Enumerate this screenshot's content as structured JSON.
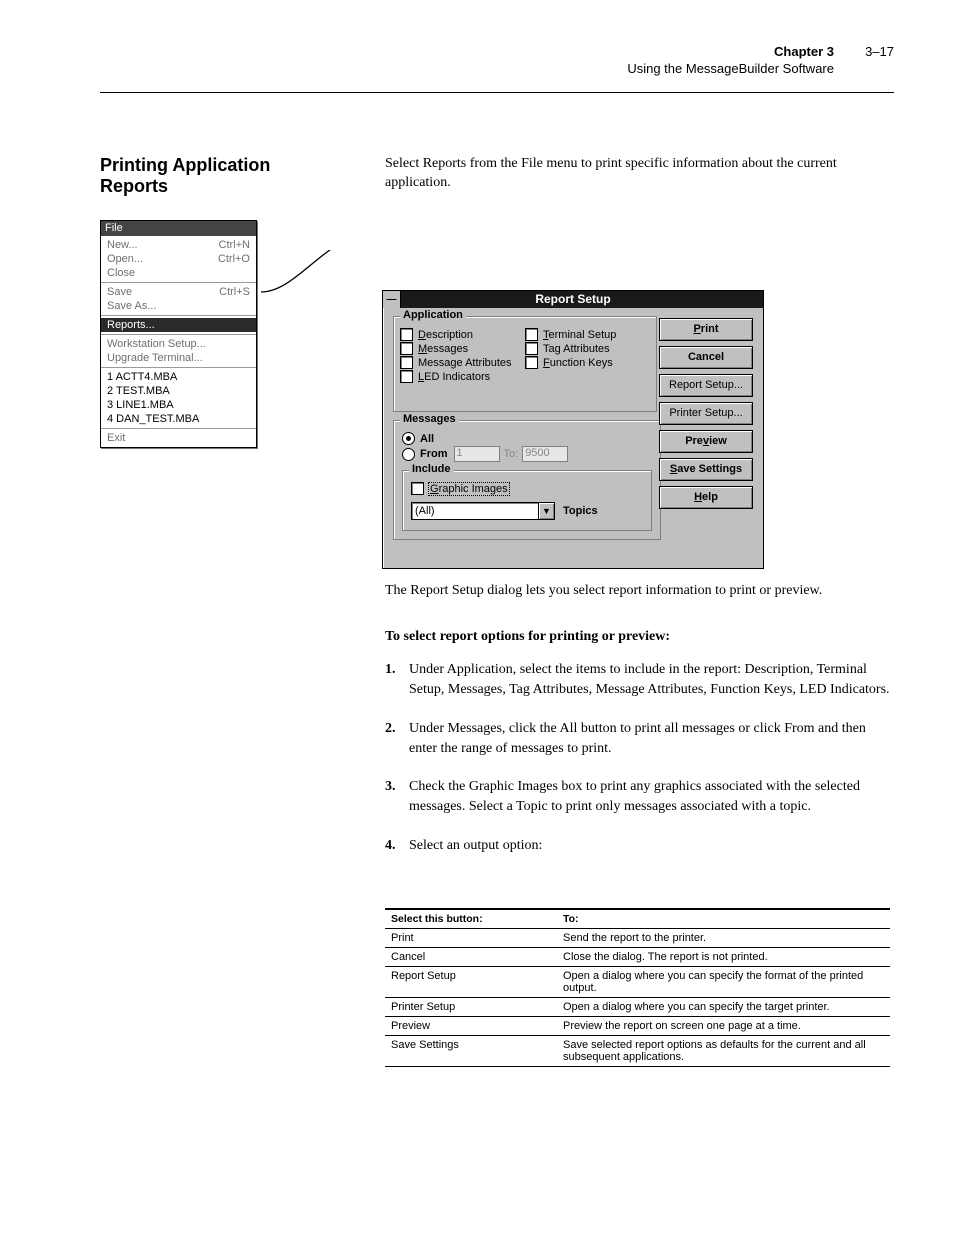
{
  "header": {
    "chapter_prefix": "Chapter 3",
    "chapter_title": "Using the MessageBuilder Software",
    "page": "3–17"
  },
  "side_title": "Printing Application Reports",
  "intro": "Select Reports from the File menu to print specific information about the current application.",
  "filemenu": {
    "title": "File",
    "groups": [
      {
        "items": [
          {
            "label": "New...",
            "shortcut": "Ctrl+N",
            "disabled": true
          },
          {
            "label": "Open...",
            "shortcut": "Ctrl+O",
            "disabled": true
          },
          {
            "label": "Close",
            "shortcut": "",
            "disabled": true
          }
        ]
      },
      {
        "items": [
          {
            "label": "Save",
            "shortcut": "Ctrl+S",
            "disabled": true
          },
          {
            "label": "Save As...",
            "shortcut": "",
            "disabled": true
          }
        ]
      },
      {
        "items": [
          {
            "label": "Reports...",
            "shortcut": "",
            "selected": true
          }
        ]
      },
      {
        "items": [
          {
            "label": "Workstation Setup...",
            "shortcut": "",
            "disabled": true
          },
          {
            "label": "Upgrade Terminal...",
            "shortcut": "",
            "disabled": true
          }
        ]
      },
      {
        "items": [
          {
            "label": "1 ACTT4.MBA",
            "shortcut": ""
          },
          {
            "label": "2 TEST.MBA",
            "shortcut": ""
          },
          {
            "label": "3 LINE1.MBA",
            "shortcut": ""
          },
          {
            "label": "4 DAN_TEST.MBA",
            "shortcut": ""
          }
        ]
      },
      {
        "items": [
          {
            "label": "Exit",
            "shortcut": "",
            "disabled": true
          }
        ]
      }
    ]
  },
  "dialog": {
    "title": "Report Setup",
    "app_group": "Application",
    "options": {
      "col1": [
        {
          "l": "Description",
          "u": "D"
        },
        {
          "l": "Messages",
          "u": "M"
        },
        {
          "l": "Message Attributes",
          "u": ""
        },
        {
          "l": "LED Indicators",
          "u": "L"
        }
      ],
      "col2": [
        {
          "l": "Terminal Setup",
          "u": "T"
        },
        {
          "l": "Tag Attributes",
          "u": ""
        },
        {
          "l": "Function Keys",
          "u": "F"
        }
      ]
    },
    "msg_group": "Messages",
    "all": "All",
    "from": "From",
    "from_val": "1",
    "to": "To:",
    "to_val": "9500",
    "include_group": "Include",
    "graphic_images": "Graphic Images",
    "combo_value": "(All)",
    "topics": "Topics",
    "buttons": {
      "print": "Print",
      "cancel": "Cancel",
      "report": "Report Setup...",
      "printer": "Printer Setup...",
      "preview": "Preview",
      "save": "Save Settings",
      "help": "Help"
    }
  },
  "after_dialog": "The Report Setup dialog lets you select report information to print or preview.",
  "steps_title": "To select report options for printing or preview:",
  "steps": [
    "Under Application, select the items to include in the report: Description, Terminal Setup, Messages, Tag Attributes, Message Attributes, Function Keys, LED Indicators.",
    "Under Messages, click the All button to print all messages or click From and then enter the range of messages to print.",
    "Check the Graphic Images box to print any graphics associated with the selected messages. Select a Topic to print only messages associated with a topic.",
    "Select an output option:"
  ],
  "table": {
    "headers": [
      "Select this button:",
      "To:"
    ],
    "rows": [
      [
        "Print",
        "Send the report to the printer."
      ],
      [
        "Cancel",
        "Close the dialog. The report is not printed."
      ],
      [
        "Report Setup",
        "Open a dialog where you can specify the format of the printed output."
      ],
      [
        "Printer Setup",
        "Open a dialog where you can specify the target printer."
      ],
      [
        "Preview",
        "Preview the report on screen one page at a time."
      ],
      [
        "Save Settings",
        "Save selected report options as defaults for the current and all subsequent applications."
      ]
    ]
  }
}
